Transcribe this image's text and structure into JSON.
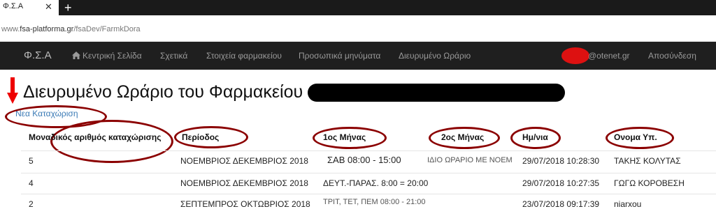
{
  "browser": {
    "tab_title": "Φ.Σ.Α",
    "tab_close": "✕",
    "new_tab": "+",
    "url_prefix": "www.",
    "url_host": "fsa-platforma.gr",
    "url_path": "/fsaDev/FarmkDora"
  },
  "navbar": {
    "brand": "Φ.Σ.Α",
    "items": [
      "Κεντρική Σελίδα",
      "Σχετικά",
      "Στοιχεία φαρμακείου",
      "Προσωπικά μηνύματα",
      "Διευρυμένο Ωράριο"
    ],
    "user_email_suffix": "@otenet.gr",
    "logout": "Αποσύνδεση"
  },
  "page": {
    "title": "Διευρυμένο Ωράριο του Φαρμακείου",
    "new_entry": "Νεα Καταχώριση"
  },
  "table": {
    "headers": [
      "Μοναδικός αριθμός καταχώρισης",
      "Περίοδος",
      "1ος Μήνας",
      "2ος Μήνας",
      "Ημ/νια",
      "Ονομα Υπ."
    ],
    "rows": [
      {
        "id": "5",
        "period": "ΝΟΕΜΒΡΙΟΣ ΔΕΚΕΜΒΡΙΟΣ 2018",
        "month1": "ΣΑΒ  08:00 - 15:00",
        "month2": "ΙΔΙΟ ΩΡΑΡΙΟ ΜΕ ΝΟΕΜ",
        "date": "29/07/2018 10:28:30",
        "name": "ΤΑΚΗΣ ΚΟΛΥΤΑΣ"
      },
      {
        "id": "4",
        "period": "ΝΟΕΜΒΡΙΟΣ ΔΕΚΕΜΒΡΙΟΣ 2018",
        "month1": "ΔΕΥΤ.-ΠΑΡΑΣ.  8:00 = 20:00",
        "month2": "",
        "date": "29/07/2018 10:27:35",
        "name": "ΓΩΓΩ ΚΟΡΟΒΕΣΗ"
      },
      {
        "id": "2",
        "period": "ΣΕΠΤΕΜΠΡΟΣ ΟΚΤΩΒΡΙΟΣ 2018",
        "month1": "ΤΡΙΤ, ΤΕΤ, ΠΕΜ  08:00 - 21:00",
        "month2": "",
        "date": "23/07/2018 09:17:39",
        "name": "niarxou"
      }
    ]
  },
  "colors": {
    "navbar_bg": "#1f1f1f",
    "annotation_red": "#8b0000",
    "link_blue": "#3a7ab5"
  }
}
